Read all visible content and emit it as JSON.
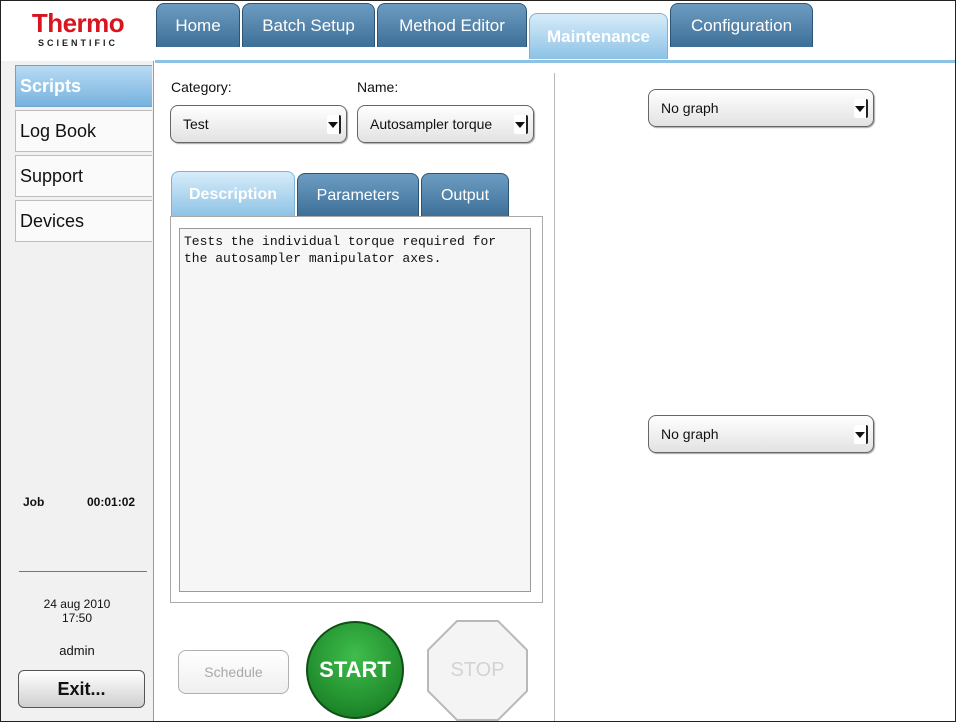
{
  "logo": {
    "line1": "Thermo",
    "line2": "SCIENTIFIC"
  },
  "nav": {
    "tabs": [
      {
        "label": "Home"
      },
      {
        "label": "Batch Setup"
      },
      {
        "label": "Method Editor"
      },
      {
        "label": "Maintenance",
        "active": true
      },
      {
        "label": "Configuration"
      }
    ]
  },
  "sidebar": {
    "items": [
      {
        "label": "Scripts",
        "active": true
      },
      {
        "label": "Log Book"
      },
      {
        "label": "Support"
      },
      {
        "label": "Devices"
      }
    ],
    "job_label": "Job",
    "job_time": "00:01:02",
    "date": "24 aug 2010",
    "time": "17:50",
    "user": "admin",
    "exit_label": "Exit..."
  },
  "form": {
    "category_label": "Category:",
    "category_value": "Test",
    "name_label": "Name:",
    "name_value": "Autosampler torque"
  },
  "subtabs": [
    {
      "label": "Description",
      "active": true
    },
    {
      "label": "Parameters"
    },
    {
      "label": "Output"
    }
  ],
  "description": "Tests the individual torque required for\nthe autosampler manipulator axes.",
  "actions": {
    "schedule_label": "Schedule",
    "start_label": "START",
    "stop_label": "STOP"
  },
  "graphs": {
    "top_value": "No graph",
    "bottom_value": "No graph"
  },
  "colors": {
    "brand": "#d8141f",
    "tab_active": "#8cc2e5",
    "tab_inactive": "#3d6f97",
    "start": "#1f8a2b"
  }
}
